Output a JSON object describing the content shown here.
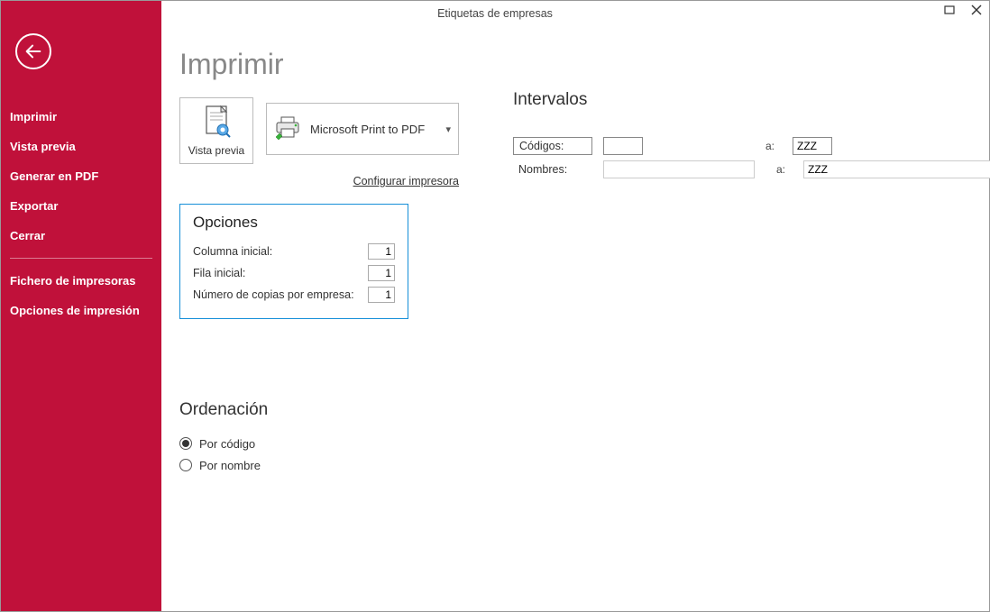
{
  "window": {
    "title": "Etiquetas de empresas"
  },
  "sidebar": {
    "items": [
      {
        "label": "Imprimir"
      },
      {
        "label": "Vista previa"
      },
      {
        "label": "Generar en PDF"
      },
      {
        "label": "Exportar"
      },
      {
        "label": "Cerrar"
      }
    ],
    "items2": [
      {
        "label": "Fichero de impresoras"
      },
      {
        "label": "Opciones de impresión"
      }
    ]
  },
  "page": {
    "title": "Imprimir",
    "preview_label": "Vista previa",
    "printer_name": "Microsoft Print to PDF",
    "config_link": "Configurar impresora"
  },
  "opciones": {
    "heading": "Opciones",
    "columna_label": "Columna inicial:",
    "columna_value": "1",
    "fila_label": "Fila inicial:",
    "fila_value": "1",
    "copias_label": "Número de copias por empresa:",
    "copias_value": "1"
  },
  "intervalos": {
    "heading": "Intervalos",
    "codigos_label": "Códigos:",
    "codigos_from": "",
    "codigos_sep": "a:",
    "codigos_to": "ZZZ",
    "nombres_label": "Nombres:",
    "nombres_from": "",
    "nombres_sep": "a:",
    "nombres_to": "ZZZ"
  },
  "ordenacion": {
    "heading": "Ordenación",
    "by_code": "Por código",
    "by_name": "Por nombre",
    "selected": "code"
  }
}
